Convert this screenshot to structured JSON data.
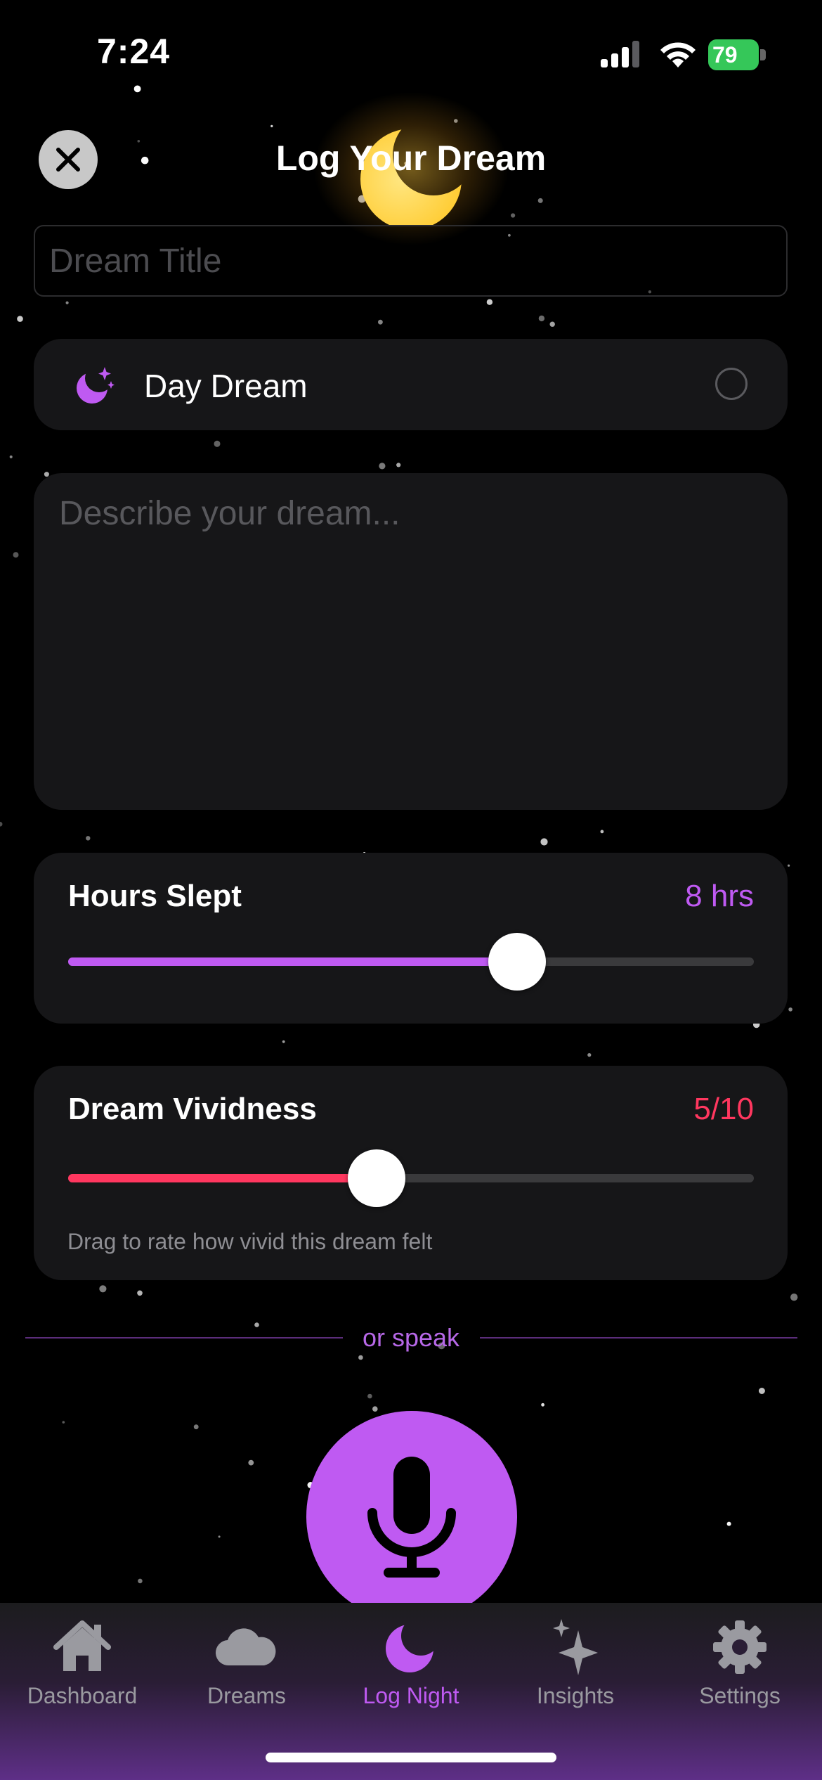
{
  "status_bar": {
    "time": "7:24",
    "battery": "79"
  },
  "header": {
    "title": "Log Your Dream",
    "close_icon": "close-icon",
    "moon_icon": "crescent-moon-icon"
  },
  "form": {
    "title_placeholder": "Dream Title",
    "title_value": "",
    "day_dream": {
      "label": "Day Dream",
      "icon": "moon-stars-icon",
      "checked": false
    },
    "description_placeholder": "Describe your dream...",
    "description_value": ""
  },
  "hours_slept": {
    "label": "Hours Slept",
    "value_text": "8 hrs",
    "fraction": 0.655,
    "color": "#bf5af2"
  },
  "vividness": {
    "label": "Dream Vividness",
    "value_text": "5/10",
    "fraction": 0.45,
    "color": "#ff375f",
    "hint": "Drag to rate how vivid this dream felt"
  },
  "voice": {
    "divider_text": "or speak",
    "mic_icon": "microphone-icon"
  },
  "tabs": [
    {
      "label": "Dashboard",
      "icon": "house-icon",
      "active": false
    },
    {
      "label": "Dreams",
      "icon": "cloud-icon",
      "active": false
    },
    {
      "label": "Log Night",
      "icon": "moon-icon",
      "active": true
    },
    {
      "label": "Insights",
      "icon": "sparkles-icon",
      "active": false
    },
    {
      "label": "Settings",
      "icon": "gear-icon",
      "active": false
    }
  ],
  "colors": {
    "accent": "#bf5af2",
    "vivid": "#ff375f",
    "battery": "#35c759",
    "card": "#161618"
  }
}
